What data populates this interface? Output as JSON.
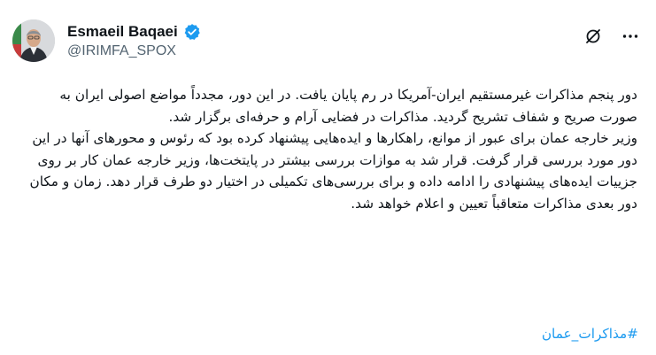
{
  "author": {
    "display_name": "Esmaeil Baqaei",
    "handle": "@IRIMFA_SPOX"
  },
  "icons": [
    "verified-badge-icon",
    "grok-icon",
    "more-options-icon"
  ],
  "colors": {
    "verified": "#1d9bf0",
    "hashtag": "#1d9bf0",
    "muted": "#536471"
  },
  "post": {
    "paragraph_1": "دور پنجم مذاکرات غیرمستقیم ایران-آمریکا در رم پایان یافت. در این دور، مجدداً مواضع اصولی ایران به صورت صریح و شفاف تشریح گردید. مذاکرات در فضایی آرام و حرفه‌ای برگزار شد.",
    "paragraph_2": "وزیر خارجه عمان برای عبور از موانع، راهکارها و ایده‌هایی پیشنهاد کرده بود که رئوس و محورهای آنها در این دور مورد بررسی قرار گرفت. قرار شد به موازات بررسی بیشتر در پایتخت‌ها، وزیر خارجه عمان کار بر روی جزییات ایده‌های پیشنهادی را ادامه داده و برای بررسی‌های تکمیلی در اختیار دو طرف قرار دهد. زمان و مکان دور بعدی مذاکرات متعاقباً تعیین و اعلام خواهد شد.",
    "hashtag": "#مذاکرات_عمان"
  }
}
